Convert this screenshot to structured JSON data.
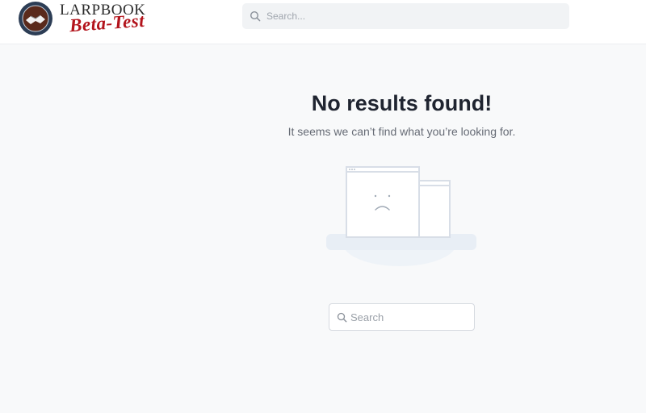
{
  "header": {
    "logo": {
      "word": "LARPBOOK",
      "script": "Beta-Test"
    },
    "search": {
      "placeholder": "Search...",
      "icon": "search-icon"
    }
  },
  "main": {
    "title": "No results found!",
    "subtitle": "It seems we can’t find what you’re looking for.",
    "illustration": "sad-browser-illustration",
    "search": {
      "placeholder": "Search",
      "icon": "search-icon"
    }
  },
  "colors": {
    "logo_script": "#b3141c",
    "title": "#1f2430",
    "page_background": "#f8f9fa"
  }
}
